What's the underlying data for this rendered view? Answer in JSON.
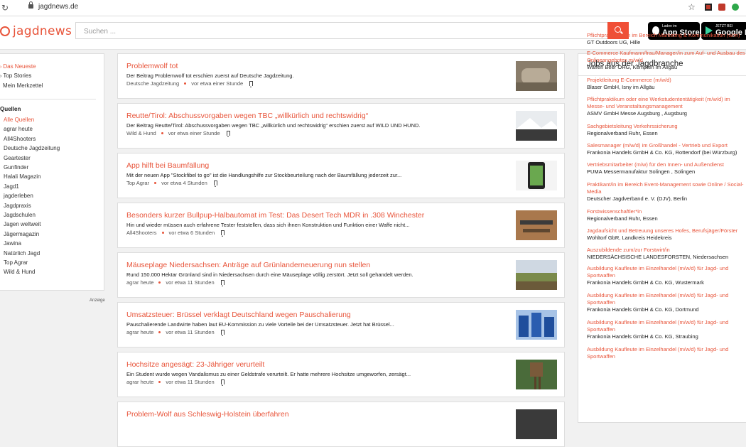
{
  "browser": {
    "url": "jagdnews.de"
  },
  "header": {
    "logo_text": "jagdnews",
    "search_placeholder": "Suchen ...",
    "appstore": {
      "small": "Laden im",
      "big": "App Store"
    },
    "googleplay": {
      "small": "JETZT BEI",
      "big": "Google Play"
    }
  },
  "sidebar": {
    "nav": [
      "Das Neueste",
      "Top Stories",
      "Mein Merkzettel"
    ],
    "sources_heading": "Quellen",
    "sources": [
      "Alle Quellen",
      "agrar heute",
      "All4Shooters",
      "Deutsche Jagdzeitung",
      "Geartester",
      "Gunfinder",
      "Halali Magazin",
      "Jagd1",
      "jagderleben",
      "Jagdpraxis",
      "Jagdschulen",
      "Jagen weltweit",
      "Jägermagazin",
      "Jawina",
      "Natürlich Jagd",
      "Top Agrar",
      "Wild & Hund"
    ],
    "ad_label": "Anzeige"
  },
  "feed": [
    {
      "title": "Problemwolf tot",
      "snippet": "Der Beitrag Problemwolf tot erschien zuerst auf Deutsche Jagdzeitung.",
      "source": "Deutsche Jagdzeitung",
      "time": "vor etwa einer Stunde"
    },
    {
      "title": "Reutte/Tirol: Abschussvorgaben wegen TBC „willkürlich und rechtswidrig“",
      "snippet": "Der Beitrag Reutte/Tirol: Abschussvorgaben wegen TBC „willkürlich und rechtswidrig“ erschien zuerst auf WILD UND HUND.",
      "source": "Wild & Hund",
      "time": "vor etwa einer Stunde"
    },
    {
      "title": "App hilft bei Baumfällung",
      "snippet": "Mit der neuen App \"Stockfibel to go\" ist die Handlungshilfe zur Stockbeurteilung nach der Baumfällung jederzeit zur...",
      "source": "Top Agrar",
      "time": "vor etwa 4 Stunden"
    },
    {
      "title": "Besonders kurzer Bullpup-Halbautomat im Test: Das Desert Tech MDR in .308 Winchester",
      "snippet": "Hin und wieder müssen auch erfahrene Tester feststellen, dass sich ihnen Konstruktion und Funktion einer Waffe nicht...",
      "source": "All4Shooters",
      "time": "vor etwa 6 Stunden"
    },
    {
      "title": "Mäuseplage Niedersachsen: Anträge auf Grünlanderneuerung nun stellen",
      "snippet": "Rund 150.000 Hektar Grünland sind in Niedersachsen durch eine Mäuseplage völlig zerstört. Jetzt soll gehandelt werden.",
      "source": "agrar heute",
      "time": "vor etwa 11 Stunden"
    },
    {
      "title": "Umsatzsteuer: Brüssel verklagt Deutschland wegen Pauschalierung",
      "snippet": "Pauschalierende Landwirte haben laut EU-Kommission zu viele Vorteile bei der Umsatzsteuer. Jetzt hat Brüssel...",
      "source": "agrar heute",
      "time": "vor etwa 11 Stunden"
    },
    {
      "title": "Hochsitze angesägt: 23-Jähriger verurteilt",
      "snippet": "Ein Student wurde wegen Vandalismus zu einer Geldstrafe verurteilt. Er hatte mehrere Hochsitze umgeworfen, zersägt...",
      "source": "agrar heute",
      "time": "vor etwa 11 Stunden"
    },
    {
      "title": "Problem-Wolf aus Schleswig-Holstein überfahren",
      "snippet": "",
      "source": "",
      "time": ""
    }
  ],
  "jobs": {
    "title": "Jobs aus der Jagdbranche",
    "items": [
      {
        "title": "Pflichtpraktikanten im Bereich Marketing & Kommunikation (w/m)",
        "company": "GT Outdoors UG, Hille"
      },
      {
        "title": "E-Commerce Kaufmann/frau/Manager/in zum Auf- und Ausbau des Onlineangebotes m/w/d",
        "company": "Waffen Beer OHG, Kempten im Allgäu"
      },
      {
        "title": "Projektleitung E-Commerce (m/w/d)",
        "company": "Blaser GmbH, Isny im Allgäu"
      },
      {
        "title": "Pflichtpraktikum oder eine Werkstudententätigkeit (m/w/d) im Messe- und Veranstaltungsmanagement",
        "company": "ASMV GmbH Messe Augsburg , Augsburg"
      },
      {
        "title": "Sachgebietsleitung Verkehrssicherung",
        "company": "Regionalverband Ruhr, Essen"
      },
      {
        "title": "Salesmanager (m/w/d) im Großhandel - Vertrieb und Export",
        "company": "Frankonia Handels GmbH & Co. KG, Rottendorf (bei Würzburg)"
      },
      {
        "title": "Vertriebsmitarbeiter (m/w) für den Innen- und Außendienst",
        "company": "PUMA Messermanufaktur Solingen , Solingen"
      },
      {
        "title": "Praktikant/in im Bereich Event-Management sowie Online / Social-Media",
        "company": "Deutscher Jagdverband e. V. (DJV), Berlin"
      },
      {
        "title": "Forstwissenschaftler*in",
        "company": "Regionalverband Ruhr, Essen"
      },
      {
        "title": "Jagdaufsicht und Betreuung unseres Hofes, Berufsjäger/Förster",
        "company": "Wohltorf GbR, Landkreis Heidekreis"
      },
      {
        "title": "Auszubildende zum/zur Forstwirt/in",
        "company": "NIEDERSÄCHSISCHE LANDESFORSTEN, Niedersachsen"
      },
      {
        "title": "Ausbildung Kaufleute im Einzelhandel (m/w/d) für Jagd- und Sportwaffen",
        "company": "Frankonia Handels GmbH & Co. KG, Wustermark"
      },
      {
        "title": "Ausbildung Kaufleute im Einzelhandel (m/w/d) für Jagd- und Sportwaffen",
        "company": "Frankonia Handels GmbH & Co. KG, Dortmund"
      },
      {
        "title": "Ausbildung Kaufleute im Einzelhandel (m/w/d) für Jagd- und Sportwaffen",
        "company": "Frankonia Handels GmbH & Co. KG, Straubing"
      },
      {
        "title": "Ausbildung Kaufleute im Einzelhandel (m/w/d) für Jagd- und Sportwaffen",
        "company": ""
      }
    ]
  }
}
